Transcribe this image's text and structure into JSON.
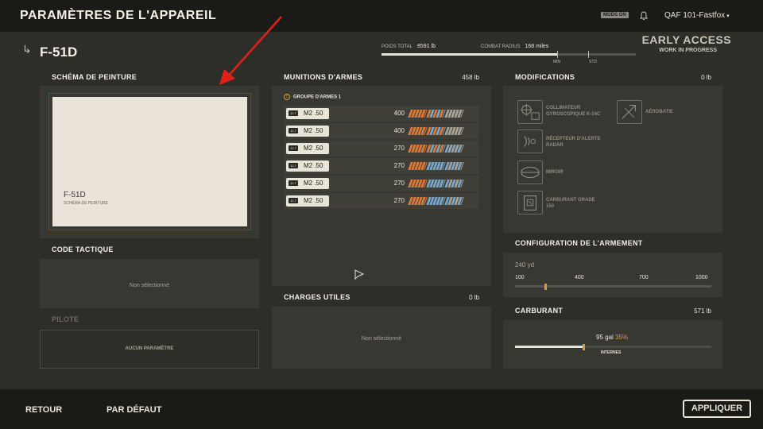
{
  "header": {
    "title": "PARAMÈTRES DE L'APPAREIL",
    "mods_badge": "MODS ON",
    "user": "QAF 101-Fastfox"
  },
  "aircraft": {
    "name": "F-51D",
    "weight_label": "POIDS TOTAL",
    "weight_value": "8591 lb",
    "radius_label": "COMBAT RADIUS",
    "radius_value": "168 miles",
    "radius_progress": 0.69,
    "tick_min": "MIN",
    "tick_std": "STD"
  },
  "early_access": {
    "line1": "EARLY ACCESS",
    "line2": "WORK IN PROGRESS"
  },
  "paint": {
    "title": "SCHÉMA DE PEINTURE",
    "name": "F-51D",
    "subtitle": "SCHÉMA DE PEINTURE :"
  },
  "tactical": {
    "title": "CODE TACTIQUE",
    "empty": "Non sélectionné"
  },
  "pilot": {
    "title": "PILOTE",
    "empty": "AUCUN PARAMÈTRE"
  },
  "munitions": {
    "title": "MUNITIONS D'ARMES",
    "weight": "458 lb",
    "group": "GROUPE D'ARMES 1",
    "rows": [
      {
        "cal": "12.7",
        "gun": "M2 .50",
        "count": "400",
        "belt": [
          "#d97a3b",
          "#d97a3b",
          "#d97a3b",
          "#7aa7c9",
          "#a7a397",
          "#a7a397"
        ]
      },
      {
        "cal": "12.7",
        "gun": "M2 .50",
        "count": "400",
        "belt": [
          "#d97a3b",
          "#d97a3b",
          "#d97a3b",
          "#7aa7c9",
          "#a7a397",
          "#a7a397"
        ]
      },
      {
        "cal": "12.7",
        "gun": "M2 .50",
        "count": "270",
        "belt": [
          "#d97a3b",
          "#d97a3b",
          "#d97a3b",
          "#7aa7c9",
          "#7aa7c9",
          "#a7a397"
        ]
      },
      {
        "cal": "12.7",
        "gun": "M2 .50",
        "count": "270",
        "belt": [
          "#d97a3b",
          "#d97a3b",
          "#7aa7c9",
          "#7aa7c9",
          "#7aa7c9",
          "#a7a397"
        ]
      },
      {
        "cal": "12.7",
        "gun": "M2 .50",
        "count": "270",
        "belt": [
          "#d97a3b",
          "#d97a3b",
          "#7aa7c9",
          "#7aa7c9",
          "#7aa7c9",
          "#a7a397"
        ]
      },
      {
        "cal": "12.7",
        "gun": "M2 .50",
        "count": "270",
        "belt": [
          "#d97a3b",
          "#d97a3b",
          "#7aa7c9",
          "#7aa7c9",
          "#7aa7c9",
          "#a7a397"
        ]
      }
    ]
  },
  "payload": {
    "title": "CHARGES UTILES",
    "weight": "0 lb",
    "empty": "Non sélectionné"
  },
  "modifications": {
    "title": "MODIFICATIONS",
    "weight": "0 lb",
    "items": [
      {
        "label1": "COLLIMATEUR",
        "label2": "GYROSCOPIQUE K-14C",
        "icon": "gunsight-icon"
      },
      {
        "label1": "AÉROBATIE",
        "label2": "",
        "icon": "aerobatics-icon"
      },
      {
        "label1": "RÉCEPTEUR D'ALERTE",
        "label2": "RADAR",
        "icon": "radar-icon"
      },
      {
        "label1": "MIROIR",
        "label2": "",
        "icon": "mirror-icon"
      },
      {
        "label1": "CARBURANT GRADE",
        "label2": "150",
        "icon": "fuel-can-icon"
      }
    ]
  },
  "armament_config": {
    "title": "CONFIGURATION DE L'ARMEMENT",
    "current": "240 yd",
    "ticks": [
      "100",
      "400",
      "700",
      "1000"
    ],
    "value": 240
  },
  "fuel": {
    "title": "CARBURANT",
    "weight": "571 lb",
    "amount": "95 gal",
    "percent": "35%",
    "fraction": 0.35,
    "tank": "INTERNES"
  },
  "footer": {
    "back": "RETOUR",
    "default": "PAR DÉFAUT",
    "apply": "APPLIQUER"
  },
  "colors": {
    "accent_orange": "#d99a3b",
    "annotation_red": "#e0201a"
  }
}
